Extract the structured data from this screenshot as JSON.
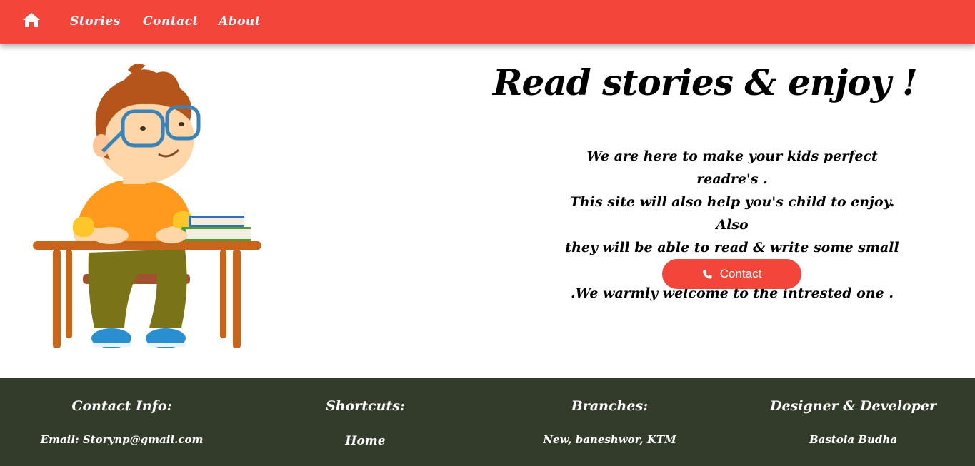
{
  "nav": {
    "home_icon": "home-icon",
    "links": [
      "Stories",
      "Contact",
      "About"
    ]
  },
  "hero": {
    "title": "Read stories & enjoy !",
    "paragraph_lines": [
      "We are here to make your kids perfect readre's .",
      "This site will also help you's child to enjoy. Also",
      "they will be able to read & write some small stories",
      ".We warmly welcome to the intrested one ."
    ],
    "button_label": "Contact",
    "button_icon": "phone-icon"
  },
  "footer": {
    "contact": {
      "title": "Contact Info:",
      "item": "Email: Storynp@gmail.com"
    },
    "shortcuts": {
      "title": "Shortcuts:",
      "item": "Home"
    },
    "branches": {
      "title": "Branches:",
      "item": "New, baneshwor, KTM"
    },
    "designer": {
      "title": "Designer & Developer",
      "item": "Bastola Budha"
    }
  },
  "colors": {
    "accent": "#f4453b",
    "footer_bg": "#333b2b",
    "text": "#000000"
  }
}
